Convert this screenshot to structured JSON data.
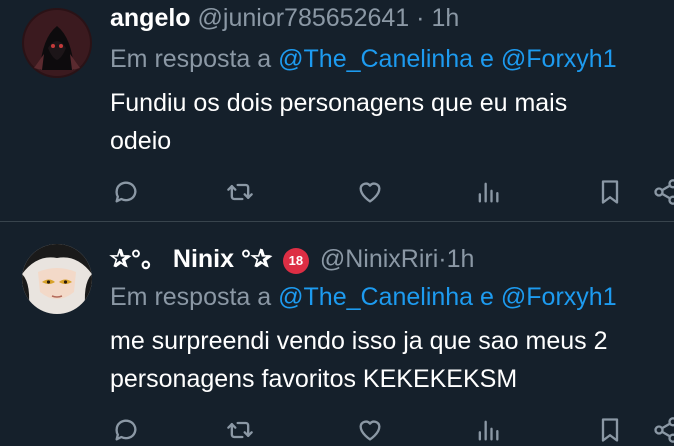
{
  "replies": [
    {
      "name": "angelo",
      "handle": "@junior785652641",
      "separator": "·",
      "time": "1h",
      "reply_prefix": "Em resposta a",
      "mention1": "@The_Canelinha",
      "conj": "e",
      "mention2": "@Forxyh1",
      "text_line1": "Fundiu os dois personagens que eu mais",
      "text_line2": "odeio"
    },
    {
      "name_prefix": "✰°。",
      "name": "Ninix",
      "name_suffix": "°✰",
      "badge": "18",
      "handle": "@NinixRiri",
      "separator": "·",
      "time": "1h",
      "reply_prefix": "Em resposta a",
      "mention1": "@The_Canelinha",
      "conj": "e",
      "mention2": "@Forxyh1",
      "text_line1": "me surpreendi vendo isso ja que sao meus 2",
      "text_line2": "personagens favoritos KEKEKEKSM"
    }
  ],
  "icons": [
    "reply-icon",
    "retweet-icon",
    "like-icon",
    "views-icon",
    "bookmark-icon",
    "share-icon"
  ],
  "colors": {
    "background": "#15202b",
    "secondary_text": "#8b98a5",
    "link": "#1d9bf0",
    "divider": "#38444d"
  }
}
